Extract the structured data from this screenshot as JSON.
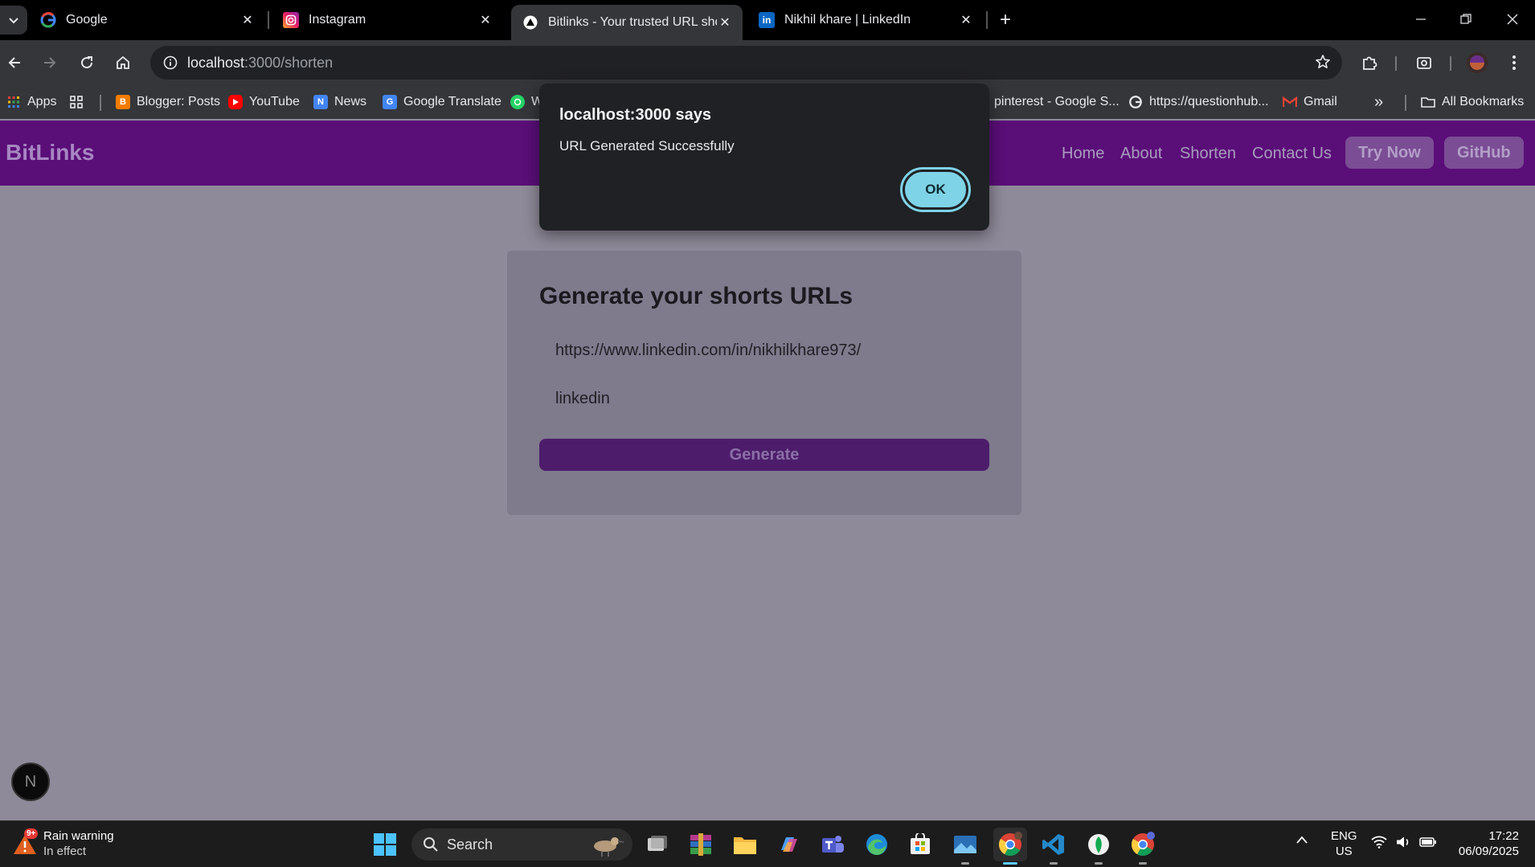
{
  "browser": {
    "tabs": [
      {
        "title": "Google",
        "active": false
      },
      {
        "title": "Instagram",
        "active": false
      },
      {
        "title": "Bitlinks - Your trusted URL shortener",
        "active": true
      },
      {
        "title": "Nikhil khare | LinkedIn",
        "active": false
      }
    ],
    "close_glyph": "✕",
    "new_tab_glyph": "+",
    "url_host": "localhost",
    "url_path": ":3000/shorten",
    "bookmarks": [
      {
        "label": "Apps"
      },
      {
        "label": "Blogger: Posts"
      },
      {
        "label": "YouTube"
      },
      {
        "label": "News"
      },
      {
        "label": "Google Translate"
      },
      {
        "label": "W"
      },
      {
        "label": "pinterest - Google S..."
      },
      {
        "label": "https://questionhub..."
      },
      {
        "label": "Gmail"
      }
    ],
    "more_bookmarks": "»",
    "all_bookmarks": "All Bookmarks"
  },
  "site": {
    "brand": "BitLinks",
    "nav": [
      {
        "label": "Home"
      },
      {
        "label": "About"
      },
      {
        "label": "Shorten"
      },
      {
        "label": "Contact Us"
      }
    ],
    "try_now": "Try Now",
    "github": "GitHub"
  },
  "form": {
    "heading": "Generate your shorts URLs",
    "url_value": "https://www.linkedin.com/in/nikhilkhare973/",
    "short_value": "linkedin",
    "generate_label": "Generate"
  },
  "next_badge": "N",
  "dialog": {
    "title": "localhost:3000 says",
    "message": "URL Generated Successfully",
    "ok_label": "OK"
  },
  "taskbar": {
    "weather_title": "Rain warning",
    "weather_sub": "In effect",
    "weather_badge": "9+",
    "search_label": "Search",
    "lang_line1": "ENG",
    "lang_line2": "US",
    "time": "17:22",
    "date": "06/09/2025"
  },
  "colors": {
    "nav_bg": "#5a0e78",
    "accent_ok": "#7fd3e6",
    "generate_bg": "#4d1d6b"
  }
}
